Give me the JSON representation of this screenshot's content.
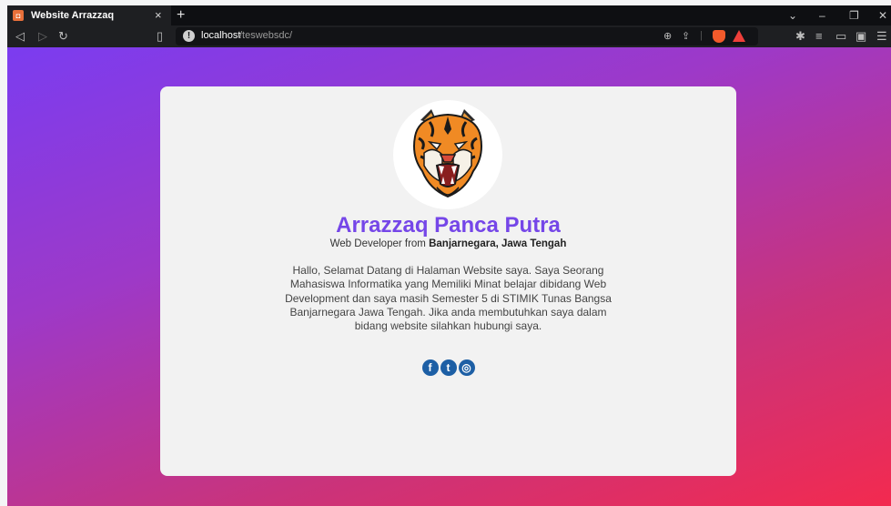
{
  "browser": {
    "tab_title": "Website Arrazzaq",
    "tab_close": "×",
    "new_tab": "+",
    "url_host": "localhost",
    "url_path": "/teswebsdc/"
  },
  "profile": {
    "name": "Arrazzaq Panca Putra",
    "tagline_prefix": "Web Developer from ",
    "tagline_location": "Banjarnegara, Jawa Tengah",
    "bio": "Hallo, Selamat Datang di Halaman Website saya. Saya Seorang Mahasiswa Informatika yang Memiliki Minat belajar dibidang Web Development dan saya masih Semester 5 di STIMIK Tunas Bangsa Banjarnegara Jawa Tengah. Jika anda membutuhkan saya dalam bidang website silahkan hubungi saya.",
    "avatar_icon": "tiger-head-icon"
  },
  "socials": [
    {
      "icon": "facebook-icon",
      "glyph": "f"
    },
    {
      "icon": "twitter-icon",
      "glyph": "t"
    },
    {
      "icon": "instagram-icon",
      "glyph": "◎"
    }
  ],
  "colors": {
    "accent": "#7546e8",
    "social": "#1d5fa5",
    "gradient_start": "#7b3cf0",
    "gradient_end": "#f32a4f"
  }
}
